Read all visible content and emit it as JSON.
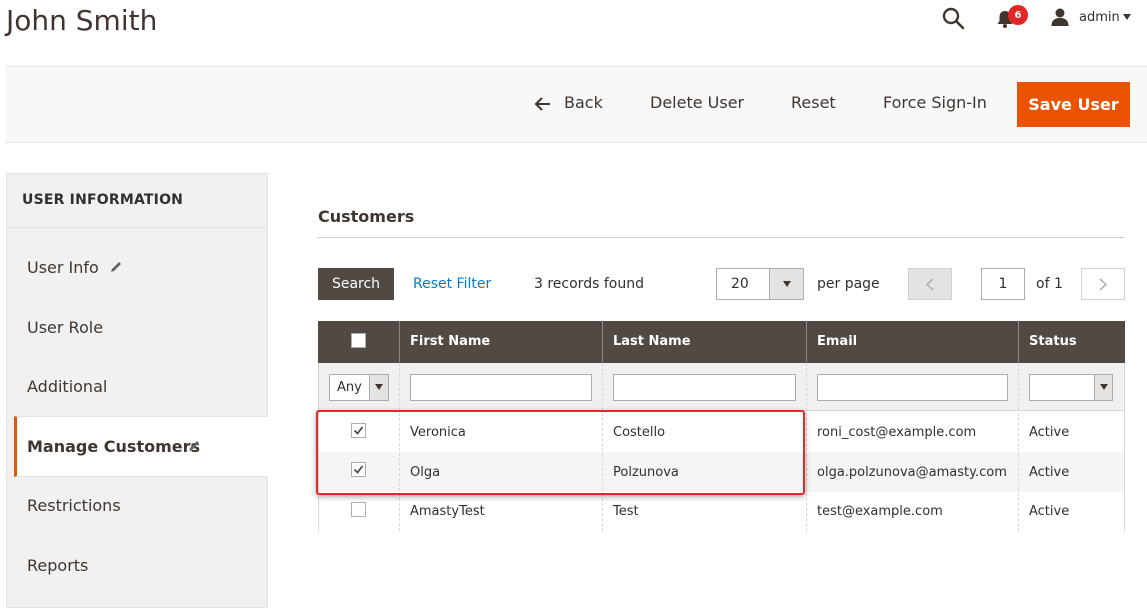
{
  "header": {
    "title": "John Smith",
    "notifications_count": "6",
    "user_label": "admin",
    "icons": [
      "search-icon",
      "bell-icon",
      "user-icon",
      "caret-down-icon"
    ]
  },
  "toolbar": {
    "back_label": "Back",
    "delete_label": "Delete User",
    "reset_label": "Reset",
    "force_signin_label": "Force Sign-In",
    "save_label": "Save User",
    "accent_color": "#eb5202"
  },
  "sidebar": {
    "heading": "USER INFORMATION",
    "items": [
      {
        "label": "User Info"
      },
      {
        "label": "User Role"
      },
      {
        "label": "Additional"
      },
      {
        "label": "Manage Customers"
      },
      {
        "label": "Restrictions"
      },
      {
        "label": "Reports"
      }
    ],
    "active_index": 3
  },
  "customers": {
    "title": "Customers",
    "search_label": "Search",
    "reset_filter_label": "Reset Filter",
    "records_found": "3 records found",
    "per_page_value": "20",
    "per_page_label": "per page",
    "page_value": "1",
    "page_of": "of 1",
    "filter_any": "Any",
    "columns": [
      "First Name",
      "Last Name",
      "Email",
      "Status"
    ],
    "rows": [
      {
        "checked": true,
        "first": "Veronica",
        "last": "Costello",
        "email": "roni_cost@example.com",
        "status": "Active"
      },
      {
        "checked": true,
        "first": "Olga",
        "last": "Polzunova",
        "email": "olga.polzunova@amasty.com",
        "status": "Active"
      },
      {
        "checked": false,
        "first": "AmastyTest",
        "last": "Test",
        "email": "test@example.com",
        "status": "Active"
      }
    ]
  }
}
